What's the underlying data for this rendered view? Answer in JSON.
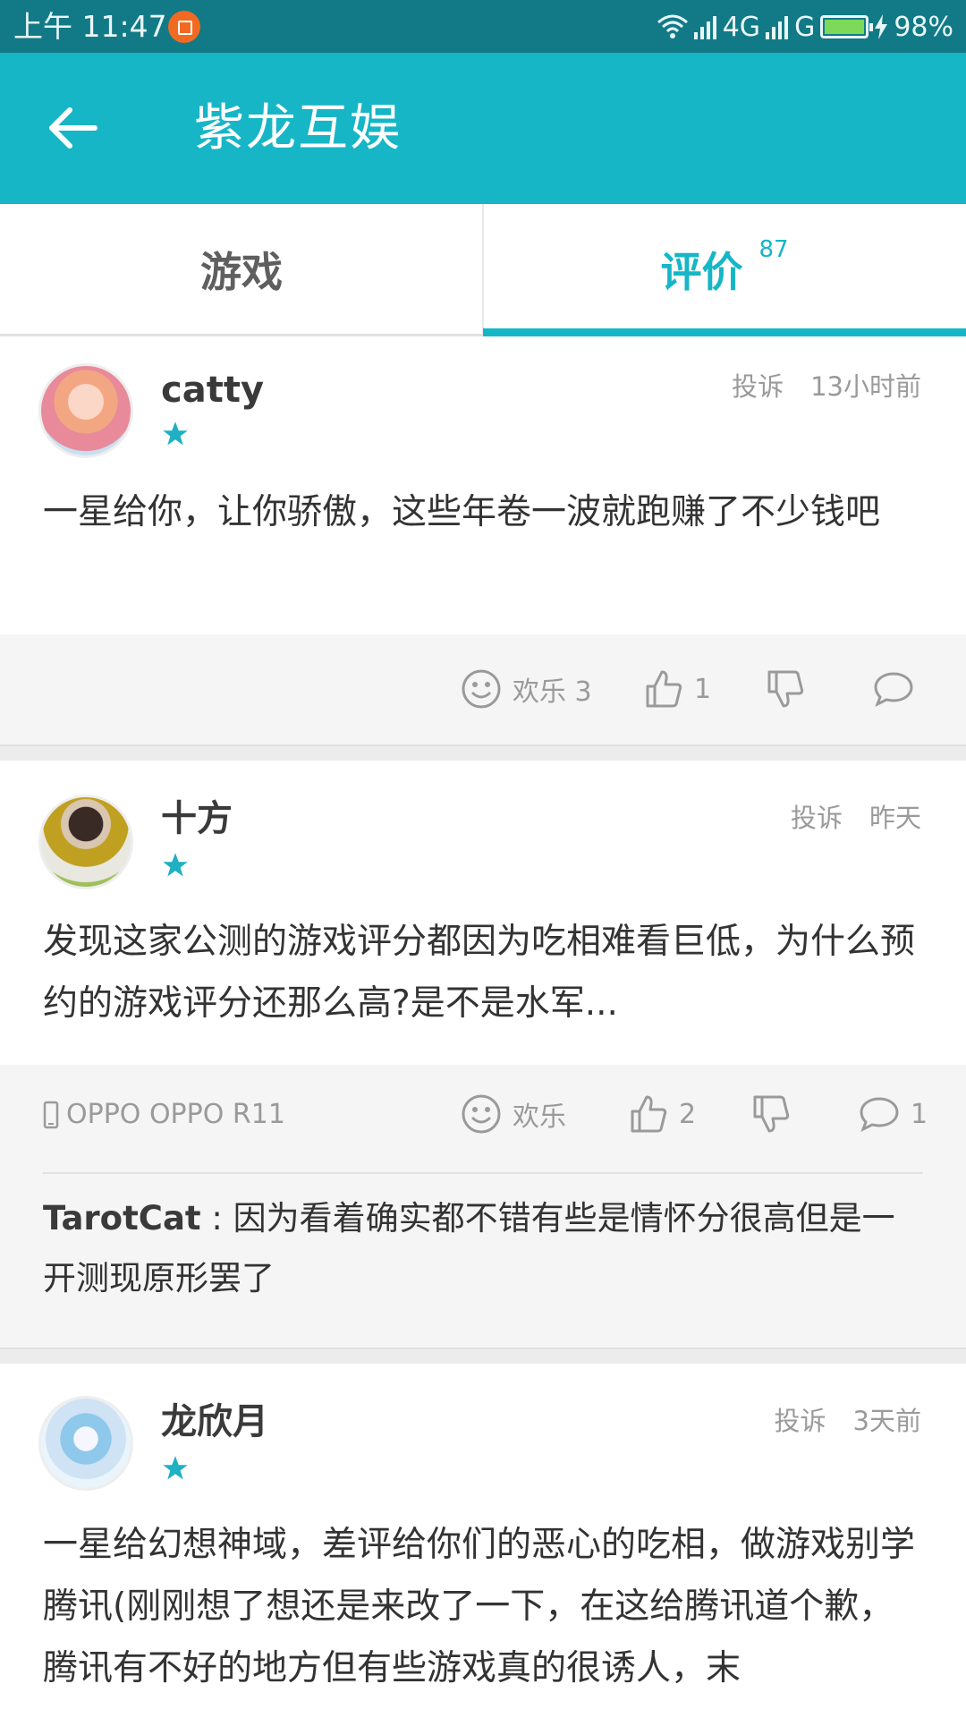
{
  "status_bar": {
    "time": "上午 11:47",
    "network": "4G",
    "network2": "G",
    "battery": "98%",
    "battery_level": 0.98
  },
  "app_bar": {
    "title": "紫龙互娱",
    "back_icon": "arrow-left-icon"
  },
  "tabs": [
    {
      "label": "游戏",
      "active": false
    },
    {
      "label": "评价",
      "count": "87",
      "active": true
    }
  ],
  "colors": {
    "accent": "#16b6c6",
    "status_bar": "#127a86",
    "star": "#1fb0c4"
  },
  "reviews": [
    {
      "user": "catty",
      "report": "投诉",
      "time": "13小时前",
      "stars": 1,
      "content": "一星给你，让你骄傲，这些年卷一波就跑赚了不少钱吧",
      "fun_label": "欢乐 3",
      "likes": "1",
      "comments": ""
    },
    {
      "user": "十方",
      "report": "投诉",
      "time": "昨天",
      "stars": 1,
      "content": "发现这家公测的游戏评分都因为吃相难看巨低，为什么预约的游戏评分还那么高?是不是水军...",
      "device": "OPPO OPPO R11",
      "fun_label": "欢乐",
      "likes": "2",
      "comments": "1",
      "reply_user": "TarotCat",
      "reply_sep": " : ",
      "reply_text": "因为看着确实都不错有些是情怀分很高但是一开测现原形罢了"
    },
    {
      "user": "龙欣月",
      "report": "投诉",
      "time": "3天前",
      "stars": 1,
      "content": "一星给幻想神域，差评给你们的恶心的吃相，做游戏别学腾讯(刚刚想了想还是来改了一下，在这给腾讯道个歉，腾讯有不好的地方但有些游戏真的很诱人，末"
    }
  ]
}
